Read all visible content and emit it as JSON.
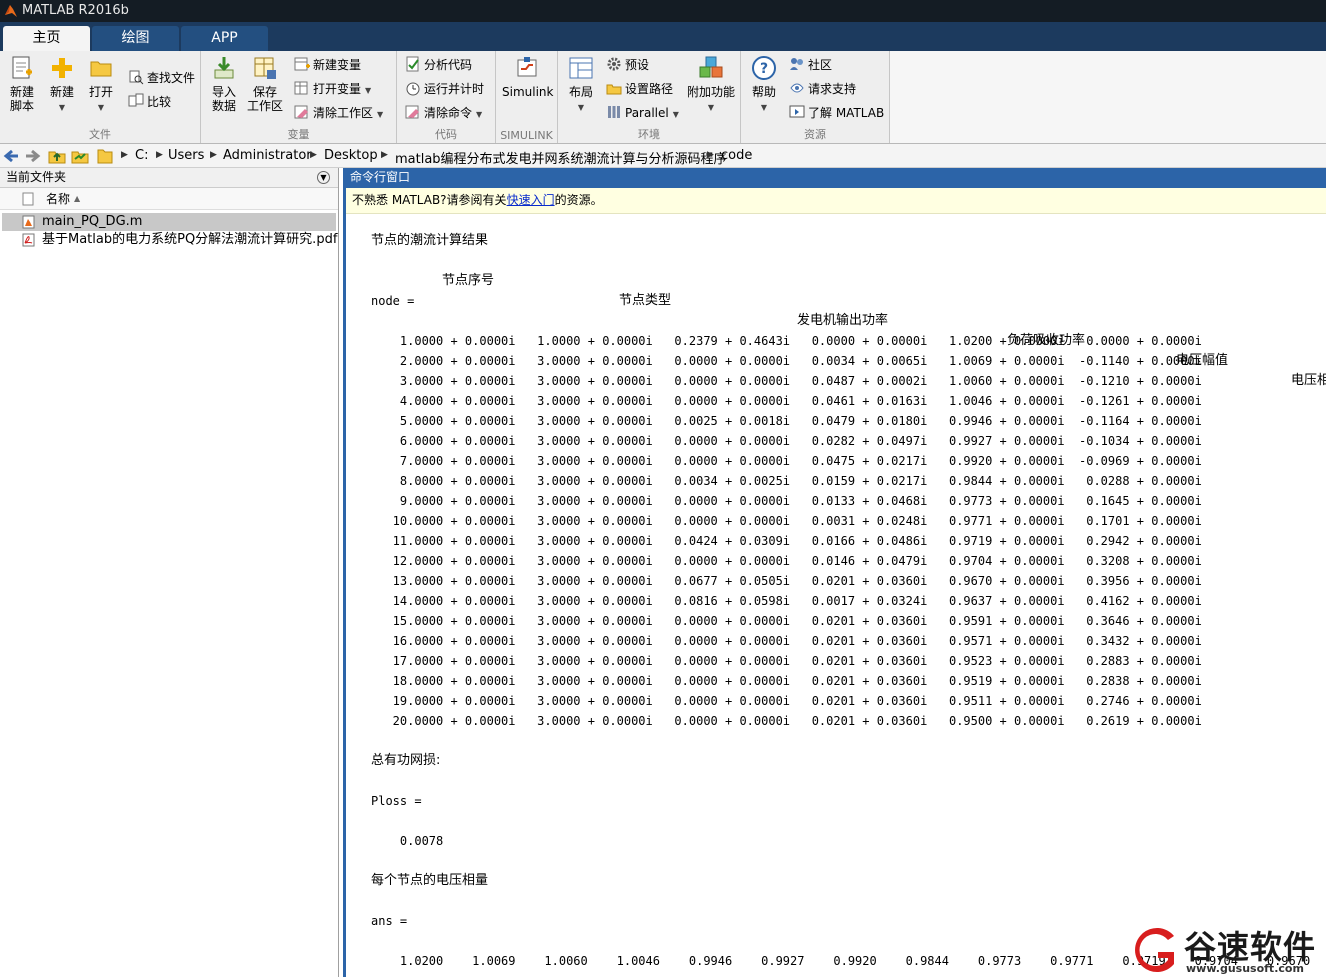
{
  "window": {
    "title": "MATLAB R2016b"
  },
  "tabs": [
    {
      "label": "主页",
      "active": true
    },
    {
      "label": "绘图",
      "active": false
    },
    {
      "label": "APP",
      "active": false
    }
  ],
  "ribbon": {
    "file": {
      "group_label": "文件",
      "new_script": "新建\n脚本",
      "new": "新建",
      "open": "打开",
      "find_files": "查找文件",
      "compare": "比较"
    },
    "variable": {
      "group_label": "变量",
      "import": "导入\n数据",
      "save": "保存\n工作区",
      "new_variable": "新建变量",
      "open_variable": "打开变量",
      "clear_workspace": "清除工作区"
    },
    "code": {
      "group_label": "代码",
      "analyze": "分析代码",
      "run_time": "运行并计时",
      "clear_commands": "清除命令"
    },
    "simulink": {
      "group_label": "SIMULINK",
      "simulink": "Simulink"
    },
    "environment": {
      "group_label": "环境",
      "layout": "布局",
      "preferences": "预设",
      "set_path": "设置路径",
      "parallel": "Parallel",
      "addons": "附加功能"
    },
    "resources": {
      "group_label": "资源",
      "help": "帮助",
      "community": "社区",
      "support": "请求支持",
      "learn": "了解 MATLAB"
    }
  },
  "address": {
    "crumbs": [
      "C:",
      "Users",
      "Administrator",
      "Desktop",
      "matlab编程分布式发电并网系统潮流计算与分析源码程序",
      "code"
    ]
  },
  "current_folder": {
    "title": "当前文件夹",
    "name_col": "名称",
    "files": [
      {
        "name": "main_PQ_DG.m",
        "selected": true,
        "type": "m"
      },
      {
        "name": "基于Matlab的电力系统PQ分解法潮流计算研究.pdf",
        "selected": false,
        "type": "pdf"
      }
    ]
  },
  "command_window": {
    "title": "命令行窗口",
    "notice_prefix": "不熟悉 MATLAB?请参阅有关",
    "notice_link": "快速入门",
    "notice_suffix": "的资源。",
    "result_title": "节点的潮流计算结果",
    "headers": [
      "节点序号",
      "节点类型",
      "发电机输出功率",
      "负荷吸收功率",
      "电压幅值",
      "电压相"
    ],
    "node_assign": "node =",
    "node_rows": [
      "    1.0000 + 0.0000i   1.0000 + 0.0000i   0.2379 + 0.4643i   0.0000 + 0.0000i   1.0200 + 0.0000i   0.0000 + 0.0000i",
      "    2.0000 + 0.0000i   3.0000 + 0.0000i   0.0000 + 0.0000i   0.0034 + 0.0065i   1.0069 + 0.0000i  -0.1140 + 0.0000i",
      "    3.0000 + 0.0000i   3.0000 + 0.0000i   0.0000 + 0.0000i   0.0487 + 0.0002i   1.0060 + 0.0000i  -0.1210 + 0.0000i",
      "    4.0000 + 0.0000i   3.0000 + 0.0000i   0.0000 + 0.0000i   0.0461 + 0.0163i   1.0046 + 0.0000i  -0.1261 + 0.0000i",
      "    5.0000 + 0.0000i   3.0000 + 0.0000i   0.0025 + 0.0018i   0.0479 + 0.0180i   0.9946 + 0.0000i  -0.1164 + 0.0000i",
      "    6.0000 + 0.0000i   3.0000 + 0.0000i   0.0000 + 0.0000i   0.0282 + 0.0497i   0.9927 + 0.0000i  -0.1034 + 0.0000i",
      "    7.0000 + 0.0000i   3.0000 + 0.0000i   0.0000 + 0.0000i   0.0475 + 0.0217i   0.9920 + 0.0000i  -0.0969 + 0.0000i",
      "    8.0000 + 0.0000i   3.0000 + 0.0000i   0.0034 + 0.0025i   0.0159 + 0.0217i   0.9844 + 0.0000i   0.0288 + 0.0000i",
      "    9.0000 + 0.0000i   3.0000 + 0.0000i   0.0000 + 0.0000i   0.0133 + 0.0468i   0.9773 + 0.0000i   0.1645 + 0.0000i",
      "   10.0000 + 0.0000i   3.0000 + 0.0000i   0.0000 + 0.0000i   0.0031 + 0.0248i   0.9771 + 0.0000i   0.1701 + 0.0000i",
      "   11.0000 + 0.0000i   3.0000 + 0.0000i   0.0424 + 0.0309i   0.0166 + 0.0486i   0.9719 + 0.0000i   0.2942 + 0.0000i",
      "   12.0000 + 0.0000i   3.0000 + 0.0000i   0.0000 + 0.0000i   0.0146 + 0.0479i   0.9704 + 0.0000i   0.3208 + 0.0000i",
      "   13.0000 + 0.0000i   3.0000 + 0.0000i   0.0677 + 0.0505i   0.0201 + 0.0360i   0.9670 + 0.0000i   0.3956 + 0.0000i",
      "   14.0000 + 0.0000i   3.0000 + 0.0000i   0.0816 + 0.0598i   0.0017 + 0.0324i   0.9637 + 0.0000i   0.4162 + 0.0000i",
      "   15.0000 + 0.0000i   3.0000 + 0.0000i   0.0000 + 0.0000i   0.0201 + 0.0360i   0.9591 + 0.0000i   0.3646 + 0.0000i",
      "   16.0000 + 0.0000i   3.0000 + 0.0000i   0.0000 + 0.0000i   0.0201 + 0.0360i   0.9571 + 0.0000i   0.3432 + 0.0000i",
      "   17.0000 + 0.0000i   3.0000 + 0.0000i   0.0000 + 0.0000i   0.0201 + 0.0360i   0.9523 + 0.0000i   0.2883 + 0.0000i",
      "   18.0000 + 0.0000i   3.0000 + 0.0000i   0.0000 + 0.0000i   0.0201 + 0.0360i   0.9519 + 0.0000i   0.2838 + 0.0000i",
      "   19.0000 + 0.0000i   3.0000 + 0.0000i   0.0000 + 0.0000i   0.0201 + 0.0360i   0.9511 + 0.0000i   0.2746 + 0.0000i",
      "   20.0000 + 0.0000i   3.0000 + 0.0000i   0.0000 + 0.0000i   0.0201 + 0.0360i   0.9500 + 0.0000i   0.2619 + 0.0000i"
    ],
    "loss_label": "总有功网损:",
    "ploss_assign": "Ploss =",
    "ploss_value": "    0.0078",
    "voltage_label": "每个节点的电压相量",
    "ans_assign": "ans =",
    "ans_row": "    1.0200    1.0069    1.0060    1.0046    0.9946    0.9927    0.9920    0.9844    0.9773    0.9771    0.9719    0.9704    0.9670"
  },
  "watermark": {
    "title": "谷速软件",
    "url": "www.gususoft.com"
  },
  "colors": {
    "title_bar": "#141c24",
    "tab_strip": "#1c3a5e",
    "cmd_header": "#2c64a8",
    "notice_bg": "#ffffe1",
    "watermark_red": "#d81e1e"
  }
}
